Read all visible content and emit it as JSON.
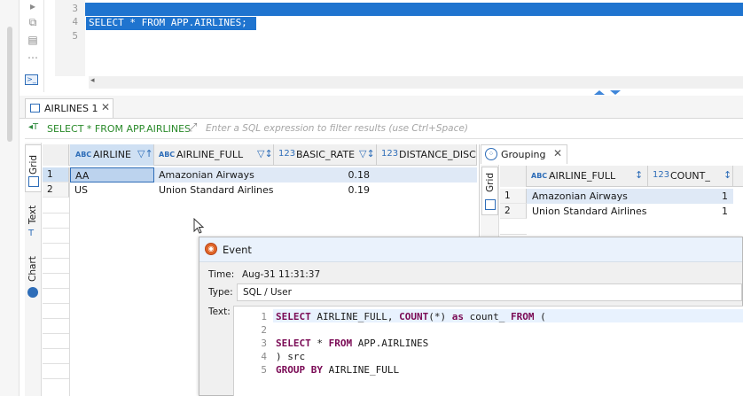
{
  "editor": {
    "line_numbers": [
      "3",
      "4",
      "5"
    ],
    "sql": "SELECT * FROM APP.AIRLINES;"
  },
  "results_tab": {
    "label": "AIRLINES 1",
    "close": "✕"
  },
  "filter": {
    "sql": "SELECT * FROM APP.AIRLINES",
    "placeholder": "Enter a SQL expression to filter results (use Ctrl+Space)"
  },
  "view_tabs": [
    "Grid",
    "Text",
    "Chart"
  ],
  "grid": {
    "columns": [
      {
        "type": "ABC",
        "name": "AIRLINE"
      },
      {
        "type": "ABC",
        "name": "AIRLINE_FULL"
      },
      {
        "type": "123",
        "name": "BASIC_RATE"
      },
      {
        "type": "123",
        "name": "DISTANCE_DISCO"
      }
    ],
    "rows": [
      {
        "num": "1",
        "airline": "AA",
        "airline_full": "Amazonian Airways",
        "basic_rate": "0.18"
      },
      {
        "num": "2",
        "airline": "US",
        "airline_full": "Union Standard Airlines",
        "basic_rate": "0.19"
      }
    ]
  },
  "grouping": {
    "tab_label": "Grouping",
    "close": "✕",
    "vtab": "Grid",
    "columns": [
      {
        "type": "ABC",
        "name": "AIRLINE_FULL"
      },
      {
        "type": "123",
        "name": "COUNT_"
      }
    ],
    "rows": [
      {
        "num": "1",
        "airline_full": "Amazonian Airways",
        "count": "1"
      },
      {
        "num": "2",
        "airline_full": "Union Standard Airlines",
        "count": "1"
      }
    ]
  },
  "event": {
    "title": "Event",
    "time_label": "Time:",
    "time_value": "Aug-31 11:31:37",
    "type_label": "Type:",
    "type_value": "SQL / User",
    "text_label": "Text:",
    "line_numbers": [
      "1",
      "2",
      "3",
      "4",
      "5"
    ]
  },
  "colors": {
    "selection": "#1f74cf",
    "accent": "#2e6db8",
    "keyword": "#7a0a55",
    "filter_sql": "#2a8a2a"
  }
}
